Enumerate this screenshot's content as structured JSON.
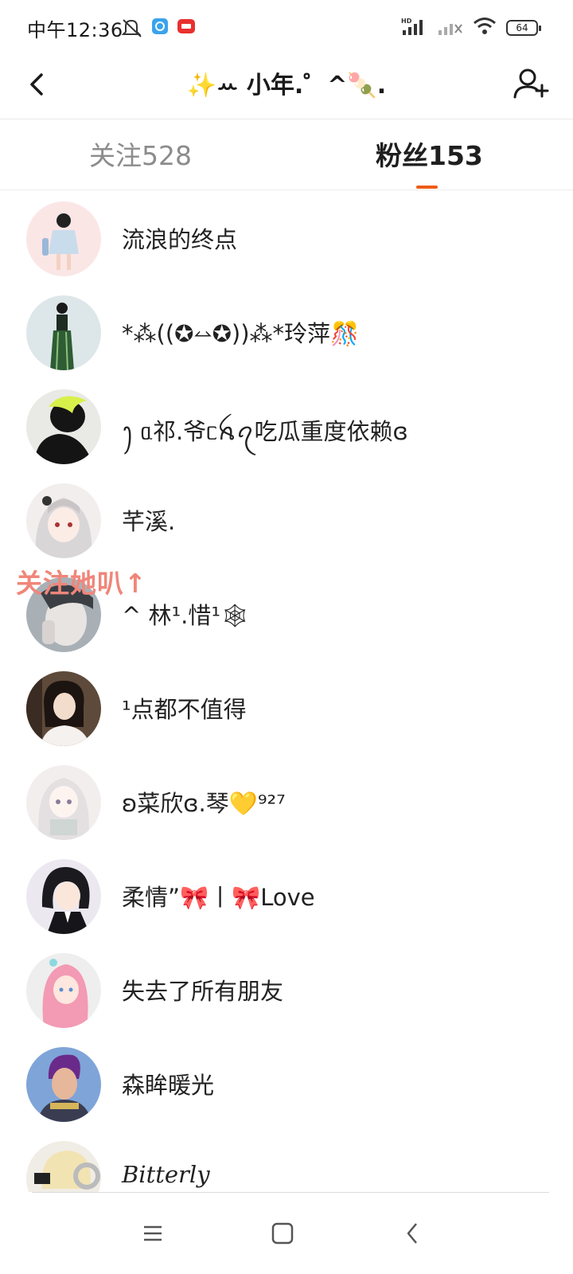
{
  "status_bar": {
    "time": "中午12:36",
    "battery": "64",
    "network_label": "HD"
  },
  "header": {
    "title": "✨ꕀ 小年.゜^🍡.",
    "back_icon": "chevron-left-icon",
    "add_icon": "add-user-icon"
  },
  "tabs": [
    {
      "label": "关注528",
      "active": false
    },
    {
      "label": "粉丝153",
      "active": true
    }
  ],
  "accent_color": "#ee5c18",
  "overlay_label": "关注她叭↑",
  "followers": [
    {
      "name": "流浪的终点"
    },
    {
      "name": "*⁂((✪⥎✪))⁂*玲萍🎊"
    },
    {
      "name": "ꫂ ᥲ祁.爷ᥴꫝꪖ吃瓜重度依赖ɞ"
    },
    {
      "name": "芊溪."
    },
    {
      "name": "^ 林¹.惜¹🕸"
    },
    {
      "name": "¹点都不值得"
    },
    {
      "name": "ʚ菜欣ɞ.琴💛⁹²⁷"
    },
    {
      "name": "柔情”🎀丨🎀Love"
    },
    {
      "name": "失去了所有朋友"
    },
    {
      "name": "森眸暖光"
    },
    {
      "name": "Bitterly"
    }
  ],
  "nav": {
    "menu_icon": "menu-icon",
    "home_icon": "home-square-icon",
    "back_icon": "back-triangle-icon"
  }
}
